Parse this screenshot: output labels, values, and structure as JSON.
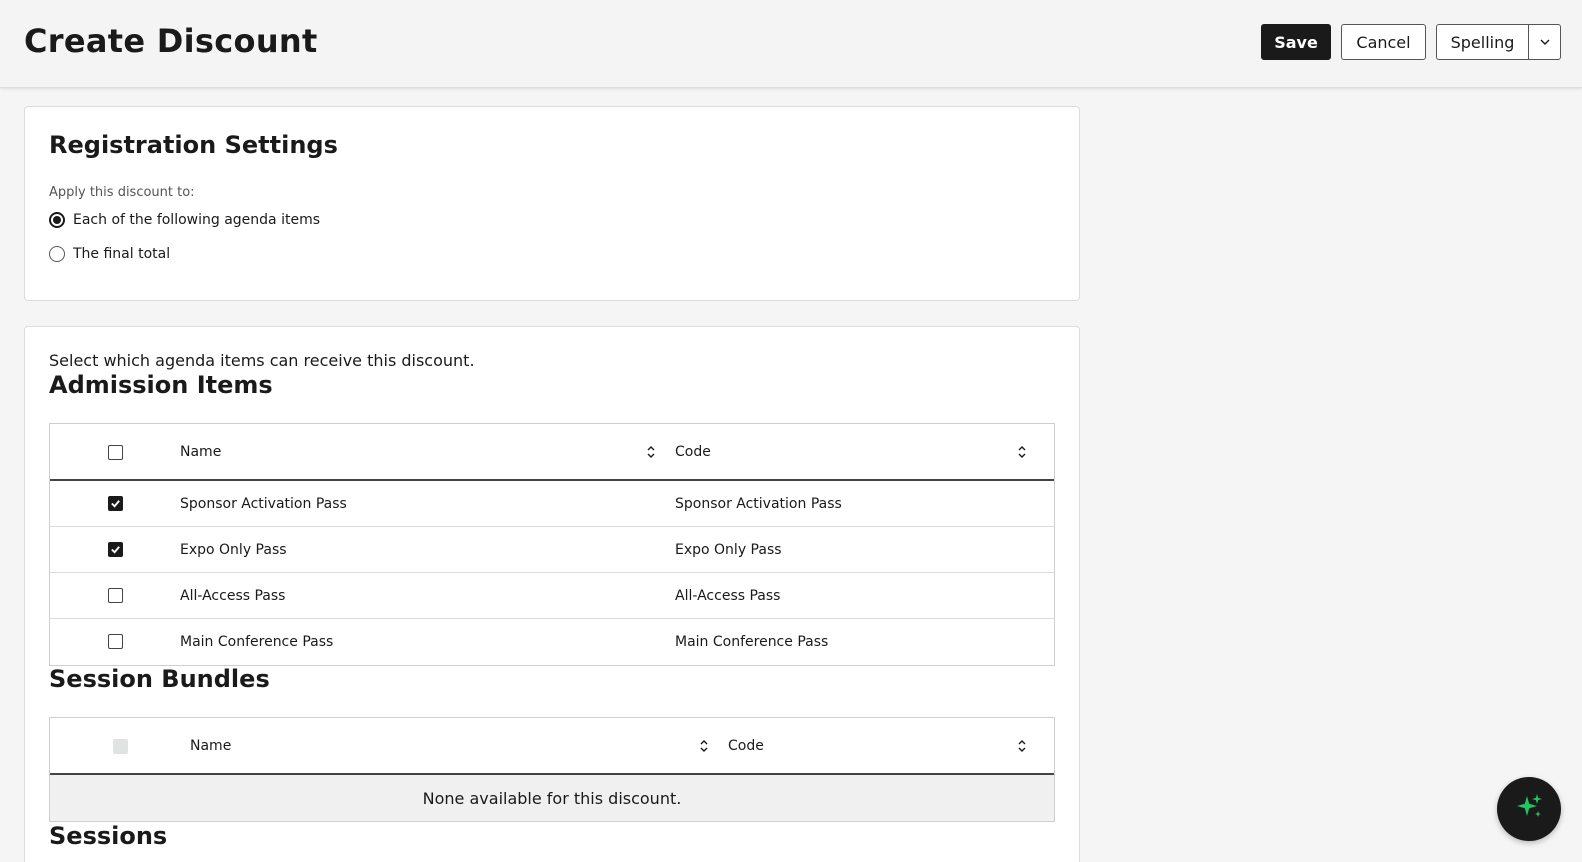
{
  "header": {
    "title": "Create Discount",
    "save_label": "Save",
    "cancel_label": "Cancel",
    "spelling_label": "Spelling"
  },
  "registration": {
    "title": "Registration Settings",
    "apply_label": "Apply this discount to:",
    "options": [
      {
        "label": "Each of the following agenda items",
        "selected": true
      },
      {
        "label": "The final total",
        "selected": false
      }
    ]
  },
  "agenda": {
    "intro": "Select which agenda items can receive this discount.",
    "admission": {
      "title": "Admission Items",
      "columns": {
        "name": "Name",
        "code": "Code"
      },
      "rows": [
        {
          "name": "Sponsor Activation Pass",
          "code": "Sponsor Activation Pass",
          "checked": true
        },
        {
          "name": "Expo Only Pass",
          "code": "Expo Only Pass",
          "checked": true
        },
        {
          "name": "All-Access Pass",
          "code": "All-Access Pass",
          "checked": false
        },
        {
          "name": "Main Conference Pass",
          "code": "Main Conference Pass",
          "checked": false
        }
      ]
    },
    "bundles": {
      "title": "Session Bundles",
      "columns": {
        "name": "Name",
        "code": "Code"
      },
      "empty_text": "None available for this discount."
    },
    "sessions": {
      "title": "Sessions"
    }
  },
  "icons": {
    "fab": "sparkles-icon",
    "sort": "sort-icon",
    "dropdown": "chevron-down-icon"
  },
  "colors": {
    "primary": "#1a1a1a",
    "fab_accent": "#22c55e"
  }
}
